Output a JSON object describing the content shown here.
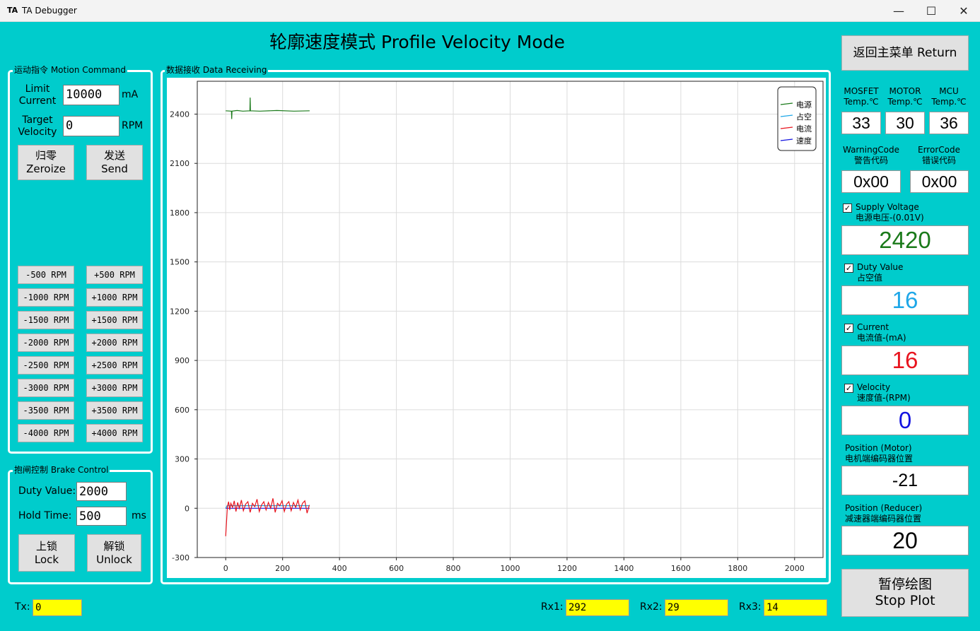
{
  "window": {
    "logo": "TA",
    "title": "TA Debugger",
    "minimize": "—",
    "maximize": "☐",
    "close": "✕"
  },
  "main_title": "轮廓速度模式 Profile Velocity Mode",
  "motion": {
    "group_title": "运动指令 Motion Command",
    "limit_current_label": "Limit\nCurrent",
    "limit_current_value": "10000",
    "limit_current_unit": "mA",
    "target_velocity_label": "Target\nVelocity",
    "target_velocity_value": "0",
    "target_velocity_unit": "RPM",
    "zeroize_button": "归零\nZeroize",
    "send_button": "发送\nSend",
    "rpm_buttons": [
      [
        "-500 RPM",
        "+500 RPM"
      ],
      [
        "-1000 RPM",
        "+1000 RPM"
      ],
      [
        "-1500 RPM",
        "+1500 RPM"
      ],
      [
        "-2000 RPM",
        "+2000 RPM"
      ],
      [
        "-2500 RPM",
        "+2500 RPM"
      ],
      [
        "-3000 RPM",
        "+3000 RPM"
      ],
      [
        "-3500 RPM",
        "+3500 RPM"
      ],
      [
        "-4000 RPM",
        "+4000 RPM"
      ]
    ]
  },
  "brake": {
    "group_title": "抱闸控制 Brake Control",
    "duty_label": "Duty Value:",
    "duty_value": "2000",
    "hold_label": "Hold  Time:",
    "hold_value": "500",
    "hold_unit": "ms",
    "lock_button": "上锁\nLock",
    "unlock_button": "解锁\nUnlock"
  },
  "data_group_title": "数据接收 Data Receiving",
  "right": {
    "return_button": "返回主菜单 Return",
    "mosfet_label": "MOSFET\nTemp.℃",
    "motor_label": "MOTOR\nTemp.℃",
    "mcu_label": "MCU\nTemp.℃",
    "mosfet_value": "33",
    "motor_value": "30",
    "mcu_value": "36",
    "warning_label": "WarningCode\n警告代码",
    "error_label": "ErrorCode\n错误代码",
    "warning_value": "0x00",
    "error_value": "0x00",
    "supply_label": "Supply Voltage\n电源电压-(0.01V)",
    "supply_value": "2420",
    "supply_color": "#1a7a1a",
    "duty_label": "Duty Value\n占空值",
    "duty_value": "16",
    "duty_color": "#1ea7e8",
    "current_label": "Current\n电流值-(mA)",
    "current_value": "16",
    "current_color": "#e8141e",
    "velocity_label": "Velocity\n速度值-(RPM)",
    "velocity_value": "0",
    "velocity_color": "#1414e0",
    "pos_motor_label": "Position (Motor)\n电机端编码器位置",
    "pos_motor_value": "-21",
    "pos_reducer_label": "Position (Reducer)\n减速器端编码器位置",
    "pos_reducer_value": "20",
    "stop_plot_button": "暂停绘图\nStop Plot",
    "check_mark": "✓"
  },
  "bottom": {
    "tx_label": "Tx:",
    "tx_value": "0",
    "rx1_label": "Rx1:",
    "rx1_value": "292",
    "rx2_label": "Rx2:",
    "rx2_value": "29",
    "rx3_label": "Rx3:",
    "rx3_value": "14"
  },
  "chart_data": {
    "type": "line",
    "xlim": [
      -100,
      2100
    ],
    "ylim": [
      -300,
      2600
    ],
    "xticks": [
      0,
      200,
      400,
      600,
      800,
      1000,
      1200,
      1400,
      1600,
      1800,
      2000
    ],
    "yticks": [
      -300,
      0,
      300,
      600,
      900,
      1200,
      1500,
      1800,
      2100,
      2400
    ],
    "grid": true,
    "legend_position": "top-right",
    "series": [
      {
        "name": "电源",
        "color": "#1a7a1a",
        "x": [
          0,
          20,
          21,
          22,
          40,
          60,
          85,
          86,
          87,
          120,
          180,
          240,
          295
        ],
        "y": [
          2420,
          2418,
          2370,
          2418,
          2422,
          2418,
          2420,
          2500,
          2420,
          2418,
          2422,
          2418,
          2420
        ]
      },
      {
        "name": "占空",
        "color": "#1ea7e8",
        "x": [
          0,
          5,
          40,
          100,
          200,
          295
        ],
        "y": [
          0,
          16,
          16,
          16,
          16,
          16
        ]
      },
      {
        "name": "电流",
        "color": "#e8141e",
        "x": [
          0,
          3,
          6,
          10,
          14,
          18,
          24,
          30,
          36,
          42,
          48,
          55,
          62,
          70,
          78,
          86,
          94,
          102,
          110,
          118,
          126,
          134,
          142,
          150,
          158,
          166,
          174,
          182,
          190,
          198,
          206,
          214,
          222,
          230,
          238,
          246,
          254,
          262,
          270,
          278,
          286,
          294
        ],
        "y": [
          -170,
          -80,
          10,
          40,
          -10,
          30,
          5,
          45,
          -20,
          35,
          0,
          50,
          -15,
          25,
          40,
          -25,
          30,
          10,
          55,
          -20,
          20,
          40,
          -10,
          35,
          0,
          60,
          -25,
          30,
          15,
          45,
          -20,
          25,
          40,
          -15,
          35,
          5,
          50,
          -10,
          30,
          45,
          -30,
          20
        ]
      },
      {
        "name": "速度",
        "color": "#1414e0",
        "x": [
          0,
          50,
          100,
          200,
          295
        ],
        "y": [
          0,
          0,
          0,
          0,
          0
        ]
      }
    ]
  }
}
